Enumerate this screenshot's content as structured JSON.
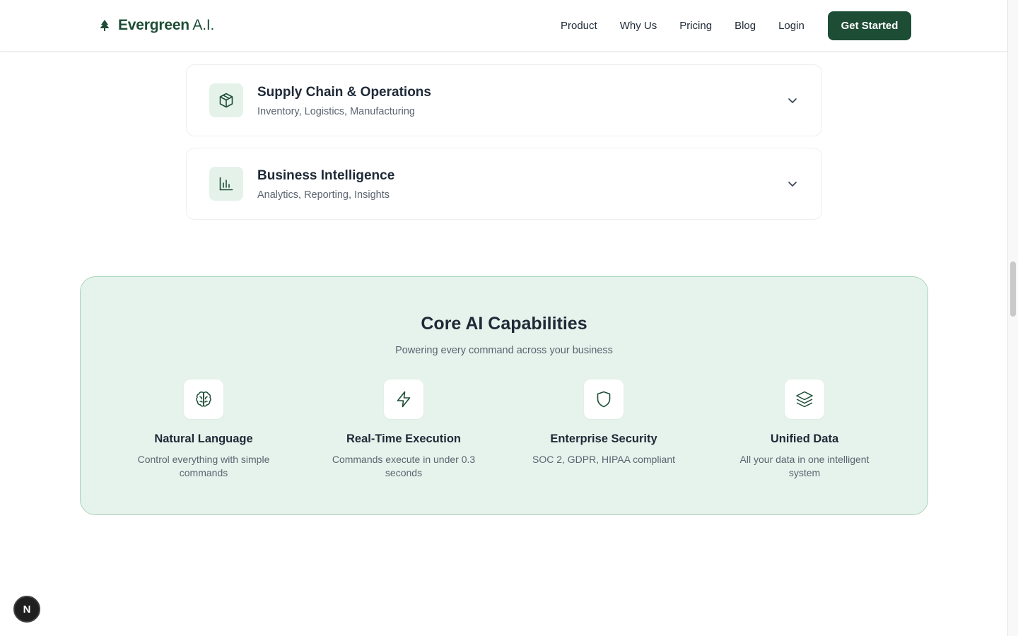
{
  "header": {
    "logo_bold": "Evergreen",
    "logo_rest": " A.I.",
    "nav": [
      "Product",
      "Why Us",
      "Pricing",
      "Blog",
      "Login"
    ],
    "cta_label": "Get Started"
  },
  "accordion": [
    {
      "title": "Supply Chain & Operations",
      "subtitle": "Inventory, Logistics, Manufacturing",
      "icon": "package-icon"
    },
    {
      "title": "Business Intelligence",
      "subtitle": "Analytics, Reporting, Insights",
      "icon": "bar-chart-icon"
    }
  ],
  "capabilities": {
    "title": "Core AI Capabilities",
    "subtitle": "Powering every command across your business",
    "items": [
      {
        "title": "Natural Language",
        "desc": "Control everything with simple commands",
        "icon": "brain-icon"
      },
      {
        "title": "Real-Time Execution",
        "desc": "Commands execute in under 0.3 seconds",
        "icon": "lightning-icon"
      },
      {
        "title": "Enterprise Security",
        "desc": "SOC 2, GDPR, HIPAA compliant",
        "icon": "shield-icon"
      },
      {
        "title": "Unified Data",
        "desc": "All your data in one intelligent system",
        "icon": "layers-icon"
      }
    ]
  },
  "badge": {
    "label": "N"
  },
  "colors": {
    "brand": "#1e4d36",
    "panel": "#e6f3ec",
    "icon_bg": "#e5f2ea"
  }
}
